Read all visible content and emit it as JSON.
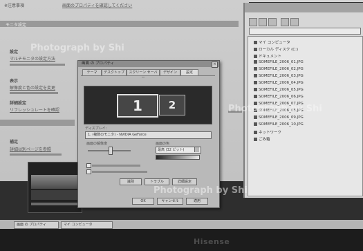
{
  "background_page": {
    "header_label": "※注意事項",
    "top_link": "画面のプロパティを確認してください",
    "section_label": "モニタ設定",
    "items": [
      {
        "heading": "設定",
        "text": "マルチモニタの設定方法"
      },
      {
        "heading": "表示",
        "text": "解像度と色の設定を変更"
      },
      {
        "heading": "詳細設定",
        "text": "リフレッシュレートを確認"
      }
    ],
    "bottom_item": {
      "heading": "補足",
      "text": "詳細は別ページを参照"
    }
  },
  "explorer": {
    "rows": [
      "マイ コンピュータ",
      "ローカル ディスク (C:)",
      "ドキュメント",
      "SOMEFILE_2006_01.JPG",
      "SOMEFILE_2006_02.JPG",
      "SOMEFILE_2006_03.JPG",
      "SOMEFILE_2006_04.JPG",
      "SOMEFILE_2006_05.JPG",
      "SOMEFILE_2006_06.JPG",
      "SOMEFILE_2006_07.JPG",
      "SOMEFILE_2006_08.JPG",
      "SOMEFILE_2006_09.JPG",
      "SOMEFILE_2006_10.JPG",
      "ネットワーク",
      "ごみ箱"
    ]
  },
  "dialog": {
    "title": "画面 の プロパティ",
    "tabs": [
      "テーマ",
      "デスクトップ",
      "スクリーン セーバー",
      "デザイン",
      "設定"
    ],
    "monitor_1": "1",
    "monitor_2": "2",
    "display_label": "ディスプレイ:",
    "display_value": "1. (複数のモニタ) - NVIDIA GeForce",
    "resolution_label": "画面の解像度",
    "color_label": "画面の色",
    "color_value": "最高 (32 ビット)",
    "btn_identify": "識別",
    "btn_troubleshoot": "トラブル",
    "btn_advanced": "詳細設定",
    "btn_ok": "OK",
    "btn_cancel": "キャンセル",
    "btn_apply": "適用"
  },
  "taskbar": {
    "items": [
      "画面 の プロパティ",
      "マイ コンピュータ"
    ]
  },
  "brand": "Hisense",
  "watermarks": [
    "Photograph by Shi",
    "Photograph by Shi",
    "Photograph by Shi"
  ]
}
